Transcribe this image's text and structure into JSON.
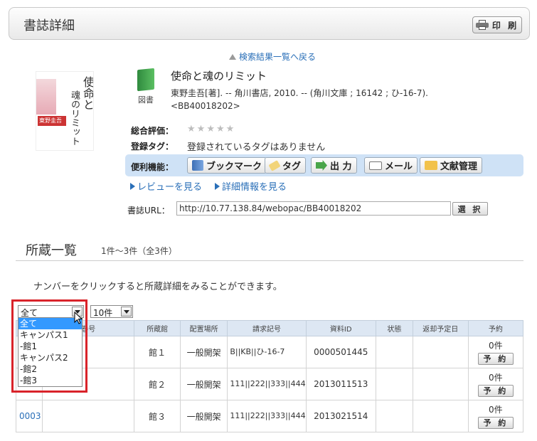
{
  "header": {
    "title": "書誌詳細",
    "print_label": "印 刷"
  },
  "back_link": "検索結果一覧へ戻る",
  "cover": {
    "title": "使命と魂のリミット",
    "title_line1": "使命と",
    "title_line2": "魂のリミット",
    "author": "東野圭吾"
  },
  "book": {
    "type_label": "図書",
    "title": "使命と魂のリミット",
    "info_line1": "東野圭吾[著]. -- 角川書店, 2010. -- (角川文庫 ; 16142 ; ひ-16-7).",
    "info_line2": "<BB40018202>"
  },
  "rating": {
    "label": "総合評価：",
    "stars": 0,
    "max": 5
  },
  "tags": {
    "label": "登録タグ：",
    "text": "登録されているタグはありません"
  },
  "tools": {
    "label": "便利機能：",
    "buttons": [
      "ブックマーク",
      "タグ",
      "出 力",
      "メール",
      "文献管理"
    ]
  },
  "links": {
    "review": "レビューを見る",
    "detail": "詳細情報を見る"
  },
  "url": {
    "label": "書誌URL：",
    "value": "http://10.77.138.84/webopac/BB40018202",
    "select_label": "選 択"
  },
  "holdings": {
    "title": "所蔵一覧",
    "count": "1件～3件（全3件）",
    "hint": "ナンバーをクリックすると所蔵詳細をみることができます。",
    "filter_value": "全て",
    "filter_options": [
      "全て",
      "キャンパス1",
      "-館1",
      "キャンパス2",
      "-館2",
      "-館3"
    ],
    "per_page": "10件",
    "columns": [
      "",
      "巻号",
      "所蔵館",
      "配置場所",
      "請求記号",
      "資料ID",
      "状態",
      "返却予定日",
      "予約"
    ],
    "rows": [
      {
        "number": "",
        "volume": "",
        "library": "館１",
        "location": "一般開架",
        "call_number": "B||KB||ひ-16-7",
        "material_id": "0000501445",
        "status": "",
        "due": "",
        "reserve_count": "0件",
        "reserve_label": "予 約"
      },
      {
        "number": "",
        "volume": "",
        "library": "館２",
        "location": "一般開架",
        "call_number": "111||222||333||444",
        "material_id": "2013011513",
        "status": "",
        "due": "",
        "reserve_count": "0件",
        "reserve_label": "予 約"
      },
      {
        "number": "0003",
        "volume": "",
        "library": "館３",
        "location": "一般開架",
        "call_number": "111||222||333||444",
        "material_id": "2013021514",
        "status": "",
        "due": "",
        "reserve_count": "0件",
        "reserve_label": "予 約"
      }
    ]
  },
  "colors": {
    "accent_blue": "#2a6fb8",
    "tools_bg": "#cfe2f6",
    "highlight_red": "#d9232a",
    "selected_option": "#3399ff"
  }
}
